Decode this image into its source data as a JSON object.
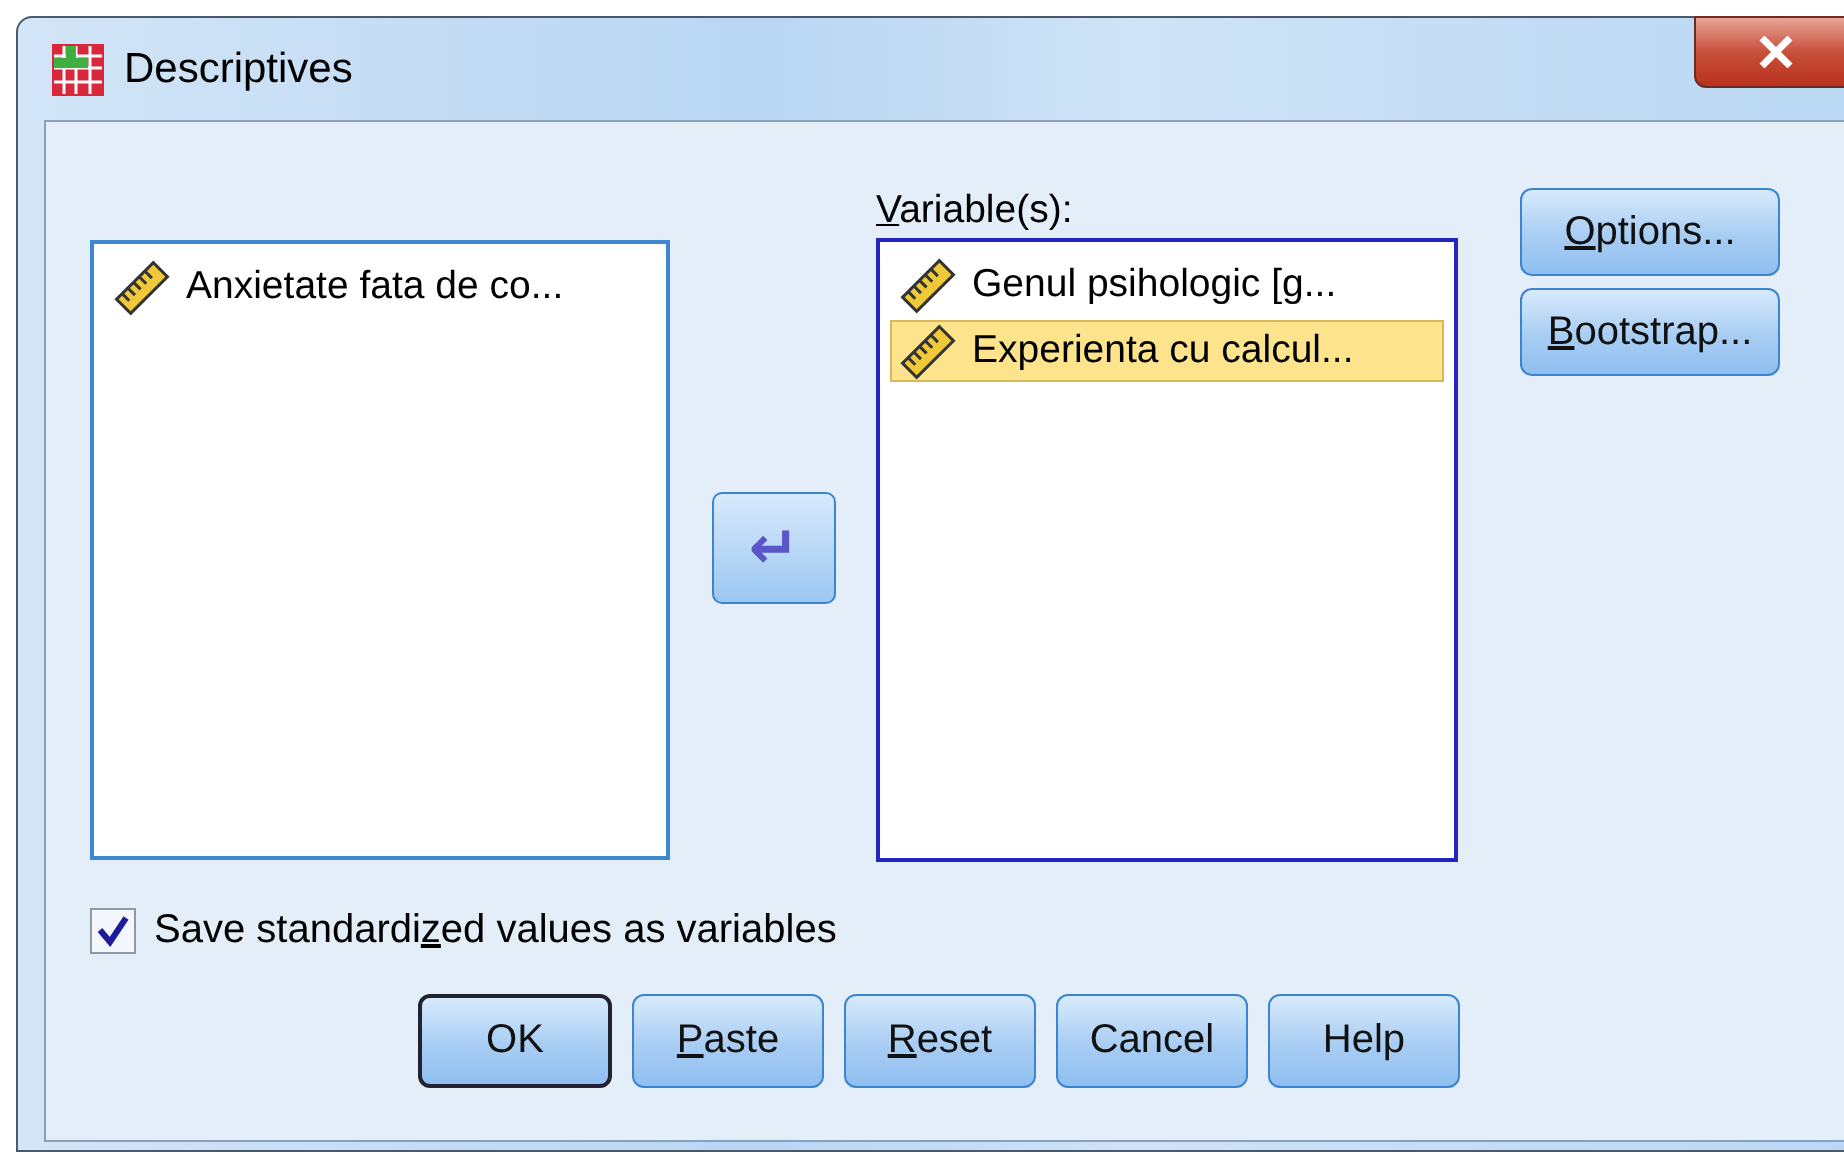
{
  "window": {
    "title": "Descriptives"
  },
  "source_list": {
    "items": [
      {
        "label": "Anxietate fata de co...",
        "selected": false
      }
    ]
  },
  "move_button": {
    "symbol": "↵"
  },
  "target_list": {
    "label": {
      "key": "V",
      "post": "ariable(s):"
    },
    "items": [
      {
        "label": "Genul psihologic [g...",
        "selected": false
      },
      {
        "label": "Experienta cu calcul...",
        "selected": true
      }
    ]
  },
  "side_buttons": [
    {
      "key": "O",
      "post": "ptions..."
    },
    {
      "key": "B",
      "post": "ootstrap..."
    }
  ],
  "save_checkbox": {
    "pre": "Save standardi",
    "key": "z",
    "post": "ed values as variables",
    "checked": true
  },
  "buttons": [
    {
      "pre": "OK",
      "default": true
    },
    {
      "key": "P",
      "post": "aste",
      "default": false
    },
    {
      "key": "R",
      "post": "eset",
      "default": false
    },
    {
      "pre": "Cancel",
      "default": false
    },
    {
      "pre": "Help",
      "default": false
    }
  ]
}
